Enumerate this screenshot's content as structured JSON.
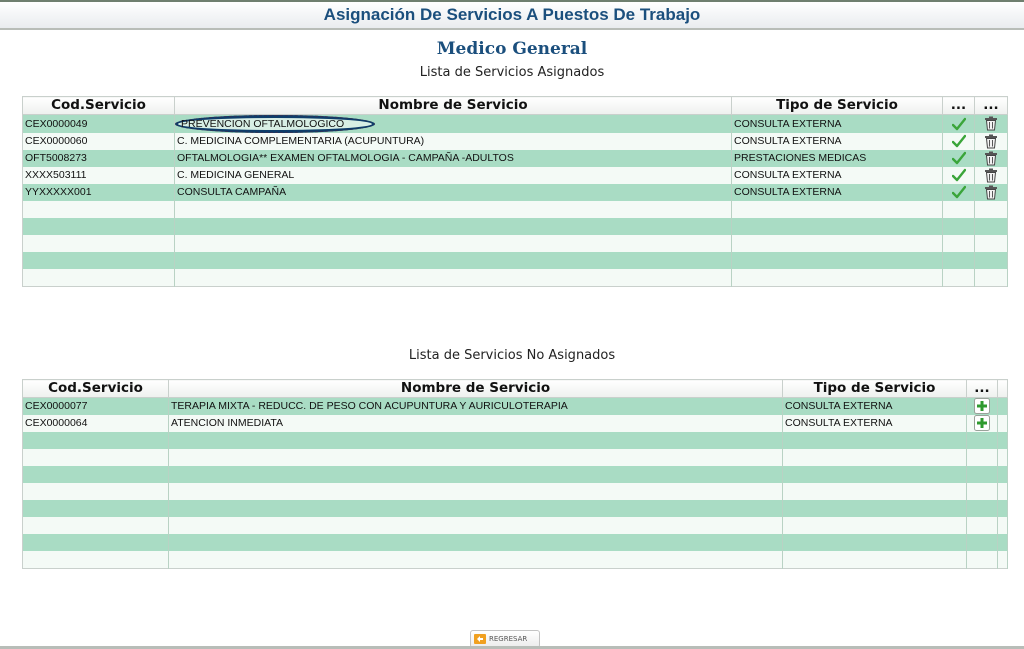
{
  "header": {
    "title": "Asignación De Servicios A Puestos De Trabajo"
  },
  "profile": {
    "name": "Medico General"
  },
  "assigned": {
    "caption": "Lista de Servicios Asignados",
    "columns": {
      "code": "Cod.Servicio",
      "name": "Nombre de Servicio",
      "type": "Tipo de Servicio",
      "action1": "...",
      "action2": "..."
    },
    "rows": [
      {
        "code": "CEX0000049",
        "name": "PREVENCION OFTALMOLOGICO",
        "type": "CONSULTA EXTERNA"
      },
      {
        "code": "CEX0000060",
        "name": "C. MEDICINA COMPLEMENTARIA (ACUPUNTURA)",
        "type": "CONSULTA EXTERNA"
      },
      {
        "code": "OFT5008273",
        "name": "OFTALMOLOGIA** EXAMEN OFTALMOLOGIA - CAMPAÑA -ADULTOS",
        "type": "PRESTACIONES MEDICAS"
      },
      {
        "code": "XXXX503111",
        "name": "C. MEDICINA GENERAL",
        "type": "CONSULTA EXTERNA"
      },
      {
        "code": "YYXXXXX001",
        "name": "CONSULTA CAMPAÑA",
        "type": "CONSULTA EXTERNA"
      }
    ]
  },
  "unassigned": {
    "caption": "Lista de Servicios No Asignados",
    "columns": {
      "code": "Cod.Servicio",
      "name": "Nombre de Servicio",
      "type": "Tipo de Servicio",
      "action": "..."
    },
    "rows": [
      {
        "code": "CEX0000077",
        "name": "TERAPIA MIXTA - REDUCC. DE PESO CON ACUPUNTURA Y AURICULOTERAPIA",
        "type": "CONSULTA EXTERNA"
      },
      {
        "code": "CEX0000064",
        "name": "ATENCION INMEDIATA",
        "type": "CONSULTA EXTERNA"
      }
    ]
  },
  "footer": {
    "back_label": "REGRESAR"
  },
  "icons": {
    "confirm": "check-icon",
    "delete": "trash-icon",
    "add": "add-icon",
    "back": "back-arrow-icon"
  },
  "colors": {
    "title": "#1b4f7d",
    "row_odd": "#a9dcc4",
    "row_even": "#f4faf6",
    "check": "#3aa53a",
    "add": "#2f9a2f"
  }
}
